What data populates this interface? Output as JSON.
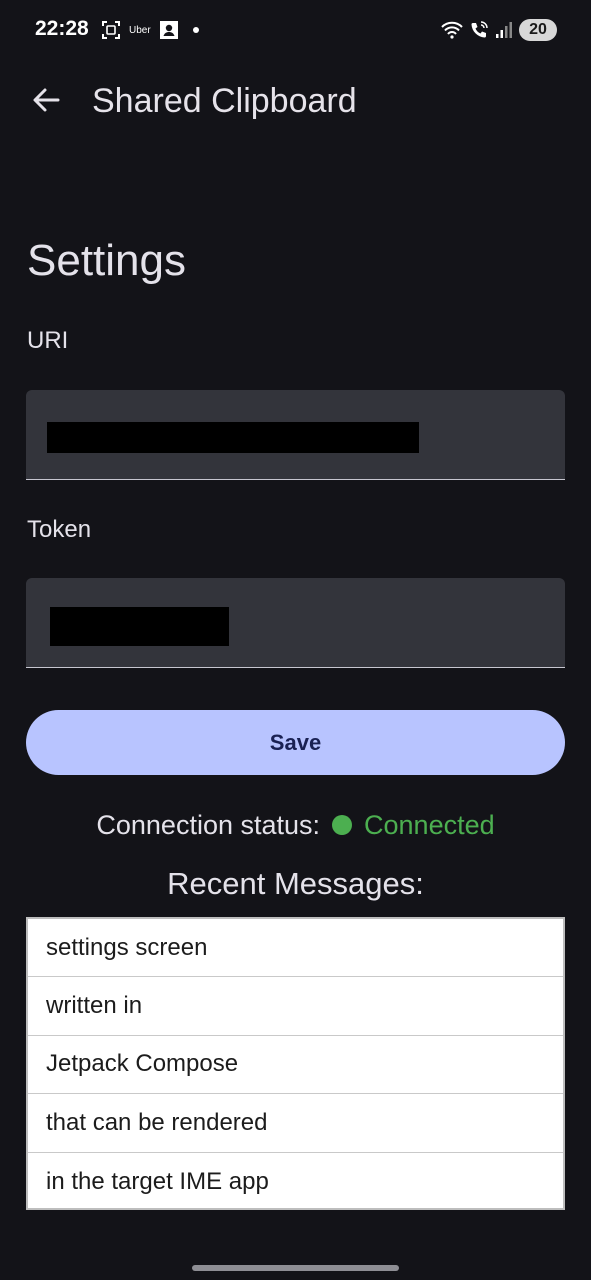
{
  "status_bar": {
    "time": "22:28",
    "left_icons": [
      "scan-icon",
      "uber-icon",
      "contact-card-icon",
      "notification-dot-icon"
    ],
    "uber_label": "Uber",
    "right_icons": [
      "wifi-icon",
      "wifi-calling-icon",
      "signal-icon"
    ],
    "battery": "20"
  },
  "app_bar": {
    "title": "Shared Clipboard",
    "back_icon": "arrow-back-icon"
  },
  "settings": {
    "title": "Settings",
    "uri_label": "URI",
    "token_label": "Token",
    "save_label": "Save"
  },
  "connection": {
    "label": "Connection status:",
    "value": "Connected",
    "status_color": "#4caf50"
  },
  "recent": {
    "title": "Recent Messages:",
    "messages": [
      "settings screen",
      "written in",
      "Jetpack Compose",
      "that can be rendered",
      "in the target IME app"
    ]
  },
  "colors": {
    "background": "#131318",
    "field_bg": "#33343b",
    "button_bg": "#b8c4ff",
    "button_text": "#1a2153"
  }
}
